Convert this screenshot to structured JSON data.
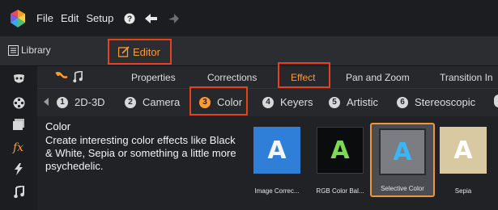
{
  "menubar": {
    "items": [
      "File",
      "Edit",
      "Setup"
    ]
  },
  "modes": {
    "library": "Library",
    "editor": "Editor"
  },
  "categories": [
    "Properties",
    "Corrections",
    "Effect",
    "Pan and Zoom",
    "Transition In"
  ],
  "subcategories": [
    {
      "num": "1",
      "label": "2D-3D"
    },
    {
      "num": "2",
      "label": "Camera"
    },
    {
      "num": "3",
      "label": "Color"
    },
    {
      "num": "4",
      "label": "Keyers"
    },
    {
      "num": "5",
      "label": "Artistic"
    },
    {
      "num": "6",
      "label": "Stereoscopic"
    }
  ],
  "description": {
    "title": "Color",
    "text": "Create interesting color effects like Black & White, Sepia or something a little more psychedelic."
  },
  "effects": [
    {
      "label": "Image Correc...",
      "letter": "A",
      "bg": "#2f7fd8",
      "fg": "#f5f5f5"
    },
    {
      "label": "RGB Color Bal...",
      "letter": "A",
      "bg": "#0b0c0d",
      "fg": "#7ed957"
    },
    {
      "label": "Selective Color",
      "letter": "A",
      "bg": "#7b7d82",
      "fg": "#39b6f5"
    },
    {
      "label": "Sepia",
      "letter": "A",
      "bg": "#d9c9a2",
      "fg": "#ffffff"
    }
  ],
  "colors": {
    "accent": "#ff9a2e",
    "highlight_box": "#e8401c"
  }
}
